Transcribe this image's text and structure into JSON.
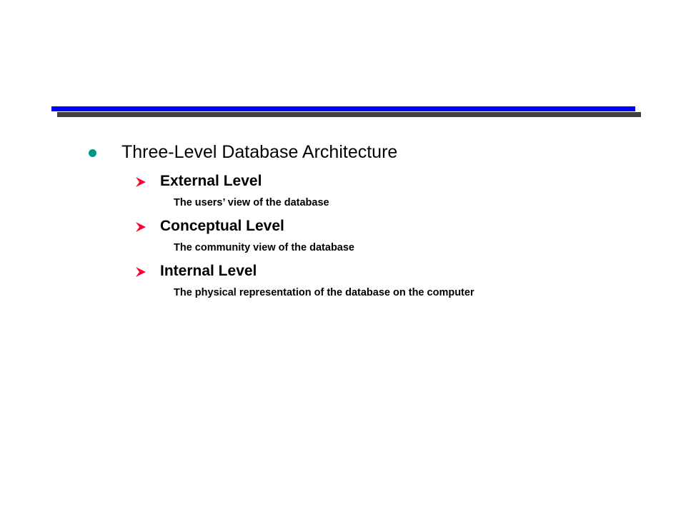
{
  "colors": {
    "accent_bar": "#0000ff",
    "shadow_bar": "#404040",
    "bullet": "#009688",
    "arrow": "#ff0033"
  },
  "title": "Three-Level Database Architecture",
  "levels": [
    {
      "name": "External Level",
      "description": "The users’ view of the database",
      "icon": "arrow-bullet-icon"
    },
    {
      "name": "Conceptual Level",
      "description": "The community view of the database",
      "icon": "arrow-bullet-icon"
    },
    {
      "name": "Internal Level",
      "description": "The physical representation of the database on the computer",
      "icon": "arrow-bullet-icon"
    }
  ]
}
